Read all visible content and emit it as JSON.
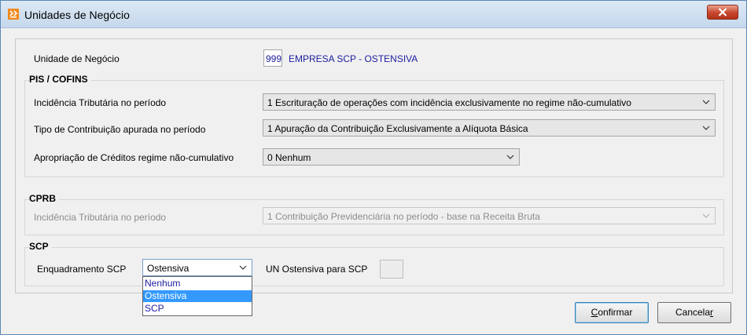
{
  "window": {
    "title": "Unidades de Negócio"
  },
  "unidade": {
    "label": "Unidade de Negócio",
    "code": "999",
    "name": "EMPRESA SCP - OSTENSIVA"
  },
  "pis_cofins": {
    "title": "PIS / COFINS",
    "incidencia": {
      "label": "Incidência Tributária no período",
      "value": "1 Escrituração de operações com incidência exclusivamente no regime não-cumulativo"
    },
    "tipo": {
      "label": "Tipo de Contribuição apurada no período",
      "value": "1 Apuração da Contribuição Exclusivamente a Alíquota Básica"
    },
    "apropriacao": {
      "label": "Apropriação de Créditos regime não-cumulativo",
      "value": "0 Nenhum"
    }
  },
  "cprb": {
    "title": "CPRB",
    "incidencia": {
      "label": "Incidência Tributária no período",
      "value": "1 Contribuição Previdenciária no período - base na Receita Bruta"
    }
  },
  "scp": {
    "title": "SCP",
    "enquadramento": {
      "label": "Enquadramento SCP",
      "value": "Ostensiva",
      "options": [
        "Nenhum",
        "Ostensiva",
        "SCP"
      ],
      "selected": "Ostensiva"
    },
    "un_ostensiva": {
      "label": "UN Ostensiva para SCP",
      "value": ""
    }
  },
  "buttons": {
    "confirm": {
      "pre": "",
      "mnemonic": "C",
      "post": "onfirmar"
    },
    "cancel": {
      "pre": "Cancela",
      "mnemonic": "r",
      "post": ""
    }
  },
  "colors": {
    "link_blue": "#1c1ca0",
    "selection": "#3399ff",
    "close_red": "#c7452c"
  },
  "icons": [
    "app-icon",
    "close-icon",
    "chevron-down-icon"
  ]
}
